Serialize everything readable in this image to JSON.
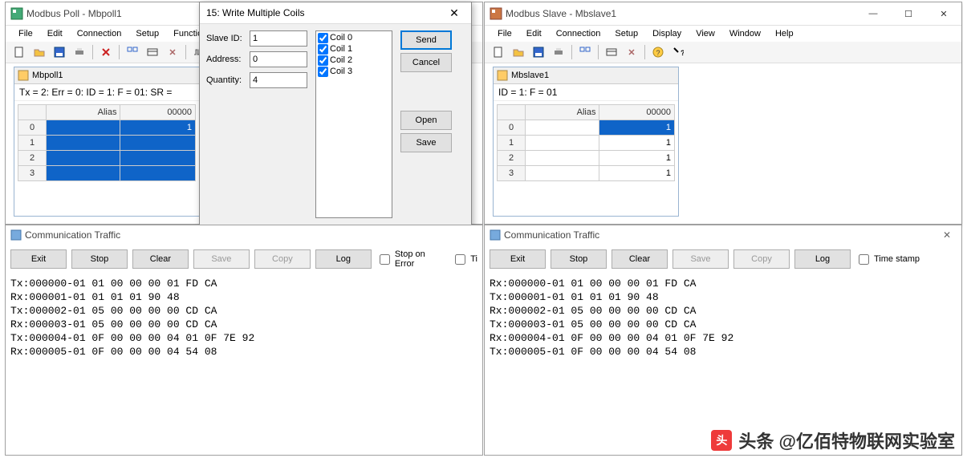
{
  "poll": {
    "title": "Modbus Poll - Mbpoll1",
    "menu": [
      "File",
      "Edit",
      "Connection",
      "Setup",
      "Function"
    ],
    "inner_title": "Mbpoll1",
    "status": "Tx = 2: Err = 0: ID = 1: F = 01: SR =",
    "col_alias": "Alias",
    "col_val": "00000",
    "rows": [
      {
        "idx": "0",
        "alias": "",
        "val": "1"
      },
      {
        "idx": "1",
        "alias": "",
        "val": ""
      },
      {
        "idx": "2",
        "alias": "",
        "val": ""
      },
      {
        "idx": "3",
        "alias": "",
        "val": ""
      }
    ]
  },
  "slave": {
    "title": "Modbus Slave - Mbslave1",
    "menu": [
      "File",
      "Edit",
      "Connection",
      "Setup",
      "Display",
      "View",
      "Window",
      "Help"
    ],
    "inner_title": "Mbslave1",
    "status": "ID = 1: F = 01",
    "col_alias": "Alias",
    "col_val": "00000",
    "rows": [
      {
        "idx": "0",
        "alias": "",
        "val": "1"
      },
      {
        "idx": "1",
        "alias": "",
        "val": "1"
      },
      {
        "idx": "2",
        "alias": "",
        "val": "1"
      },
      {
        "idx": "3",
        "alias": "",
        "val": "1"
      }
    ]
  },
  "dialog": {
    "title": "15: Write Multiple Coils",
    "slaveid_label": "Slave ID:",
    "slaveid": "1",
    "address_label": "Address:",
    "address": "0",
    "quantity_label": "Quantity:",
    "quantity": "4",
    "coils": [
      "Coil 0",
      "Coil 1",
      "Coil 2",
      "Coil 3"
    ],
    "btn_send": "Send",
    "btn_cancel": "Cancel",
    "btn_open": "Open",
    "btn_save": "Save"
  },
  "traffic_left": {
    "title": "Communication Traffic",
    "btns": {
      "exit": "Exit",
      "stop": "Stop",
      "clear": "Clear",
      "save": "Save",
      "copy": "Copy",
      "log": "Log"
    },
    "chk1": "Stop on Error",
    "chk2": "Ti",
    "log": "Tx:000000-01 01 00 00 00 01 FD CA\nRx:000001-01 01 01 01 90 48\nTx:000002-01 05 00 00 00 00 CD CA\nRx:000003-01 05 00 00 00 00 CD CA\nTx:000004-01 0F 00 00 00 04 01 0F 7E 92\nRx:000005-01 0F 00 00 00 04 54 08"
  },
  "traffic_right": {
    "title": "Communication Traffic",
    "btns": {
      "exit": "Exit",
      "stop": "Stop",
      "clear": "Clear",
      "save": "Save",
      "copy": "Copy",
      "log": "Log"
    },
    "chk": "Time stamp",
    "log": "Rx:000000-01 01 00 00 00 01 FD CA\nTx:000001-01 01 01 01 90 48\nRx:000002-01 05 00 00 00 00 CD CA\nTx:000003-01 05 00 00 00 00 CD CA\nRx:000004-01 0F 00 00 00 04 01 0F 7E 92\nTx:000005-01 0F 00 00 00 04 54 08"
  },
  "wm": "头条 @亿佰特物联网实验室"
}
